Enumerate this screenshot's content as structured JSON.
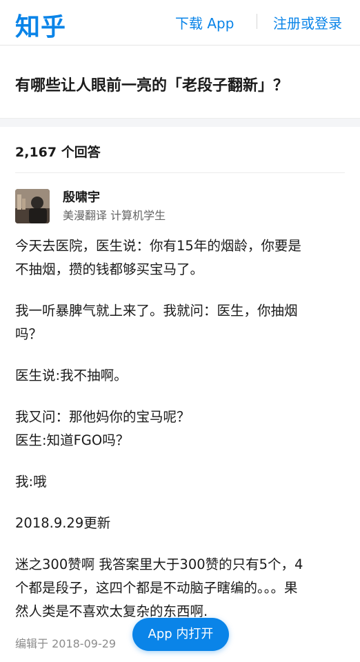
{
  "header": {
    "logo": "知乎",
    "download_label": "下载 App",
    "login_label": "注册或登录"
  },
  "question": {
    "title": "有哪些让人眼前一亮的「老段子翻新」？"
  },
  "answers": {
    "count_label": "2,167 个回答"
  },
  "author": {
    "name": "殷啸宇",
    "bio": "美漫翻译 计算机学生"
  },
  "content": {
    "paragraphs": [
      [
        "今天去医院，医生说：你有15年的烟龄，你要是",
        "不抽烟，攒的钱都够买宝马了。"
      ],
      [
        "我一听暴脾气就上来了。我就问：医生，你抽烟",
        "吗？"
      ],
      [
        "医生说:我不抽啊。"
      ],
      [
        "我又问：那他妈你的宝马呢？",
        "医生:知道FGO吗？"
      ],
      [
        "我:哦"
      ],
      [
        "2018.9.29更新"
      ],
      [
        "迷之300赞啊 我答案里大于300赞的只有5个，4",
        "个都是段子，这四个都是不动脑子瞎编的。。。果",
        "然人类是不喜欢太复杂的东西啊."
      ]
    ]
  },
  "footer": {
    "edit_time": "编辑于 2018-09-29",
    "open_app_label": "App 内打开"
  }
}
